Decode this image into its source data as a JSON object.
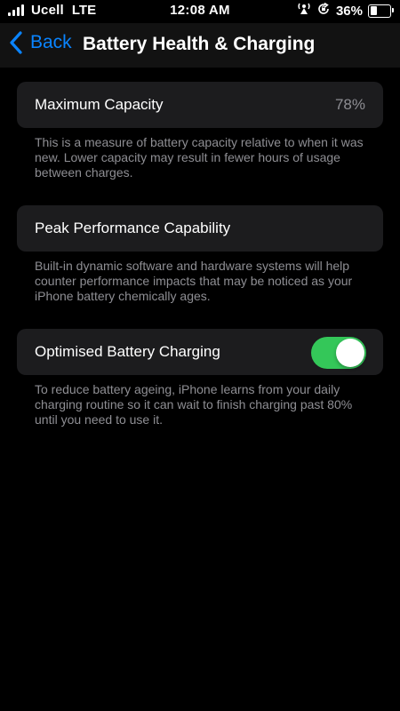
{
  "status_bar": {
    "carrier": "Ucell",
    "network": "LTE",
    "time": "12:08 AM",
    "battery_percent": "36%",
    "battery_level": 0.36,
    "icons": [
      "signal-icon",
      "hotspot-icon",
      "orientation-lock-icon",
      "battery-icon"
    ]
  },
  "nav": {
    "back_label": "Back",
    "title": "Battery Health & Charging",
    "accent_color": "#0a84ff"
  },
  "sections": {
    "max_capacity": {
      "label": "Maximum Capacity",
      "value": "78%",
      "footnote": "This is a measure of battery capacity relative to when it was new. Lower capacity may result in fewer hours of usage between charges."
    },
    "peak_performance": {
      "label": "Peak Performance Capability",
      "footnote": "Built-in dynamic software and hardware systems will help counter performance impacts that may be noticed as your iPhone battery chemically ages."
    },
    "optimised_charging": {
      "label": "Optimised Battery Charging",
      "enabled": true,
      "toggle_color": "#34c759",
      "footnote": "To reduce battery ageing, iPhone learns from your daily charging routine so it can wait to finish charging past 80% until you need to use it."
    }
  }
}
